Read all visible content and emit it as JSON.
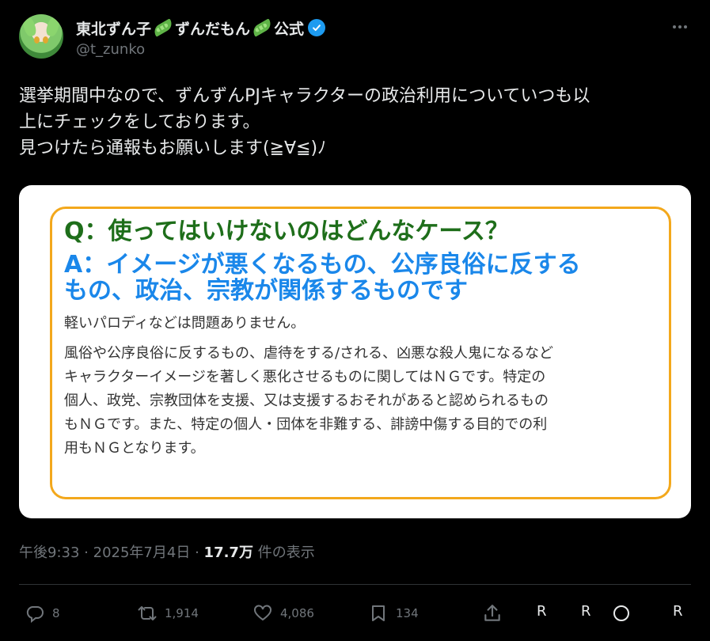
{
  "author": {
    "display_name_part1": "東北ずん子",
    "display_name_part2": "ずんだもん",
    "display_name_part3": "公式",
    "handle": "@t_zunko"
  },
  "tweet": {
    "lines": [
      "選挙期間中なので、ずんずんPJキャラクターの政治利用についていつも以",
      "上にチェックをしております。",
      "見つけたら通報もお願いします(≧∀≦)ﾉ"
    ]
  },
  "image_card": {
    "question": "Q：使ってはいけないのはどんなケース？",
    "answer_lines": [
      "A：イメージが悪くなるもの、公序良俗に反する",
      "もの、政治、宗教が関係するものです"
    ],
    "light_note": "軽いパロディなどは問題ありません。",
    "body_lines": [
      "風俗や公序良俗に反するもの、虐待をする/される、凶悪な殺人鬼になるなど",
      "キャラクターイメージを著しく悪化させるものに関してはＮＧです。特定の",
      "個人、政党、宗教団体を支援、又は支援するおそれがあると認められるもの",
      "もＮＧです。また、特定の個人・団体を非難する、誹謗中傷する目的での利",
      "用もＮＧとなります。"
    ]
  },
  "meta": {
    "time": "午後9:33",
    "sep1": "·",
    "date": "2025年7月4日",
    "sep2": "·",
    "views": "17.7万",
    "views_suffix": "件の表示"
  },
  "actions": {
    "reply_count": "8",
    "retweet_count": "1,914",
    "like_count": "4,086",
    "bookmark_count": "134",
    "r1": "R",
    "r2": "R",
    "r3": "R"
  },
  "icons": {
    "verified": "verified-badge-icon",
    "more": "more-horizontal-icon",
    "reply": "reply-icon",
    "retweet": "retweet-icon",
    "like": "heart-icon",
    "bookmark": "bookmark-icon",
    "share": "share-icon"
  },
  "colors": {
    "verified": "#1d9bf0",
    "question": "#1e6e1a",
    "answer": "#1a87ea",
    "card_border": "#f3a81c"
  }
}
